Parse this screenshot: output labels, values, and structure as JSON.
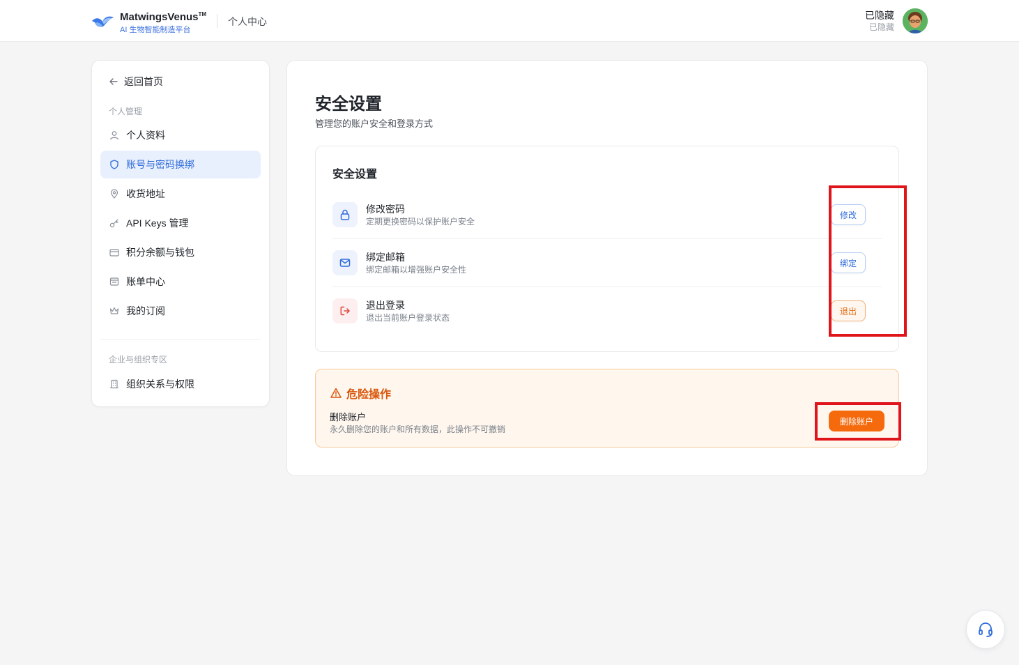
{
  "header": {
    "brand": "MatwingsVenus",
    "brand_tm": "TM",
    "brand_sub": "AI 生物智能制造平台",
    "crumb": "个人中心",
    "user_name": "已隐藏",
    "user_sub": "已隐藏"
  },
  "sidebar": {
    "back": "返回首页",
    "section_personal": "个人管理",
    "items": [
      {
        "label": "个人资料",
        "icon": "user-icon"
      },
      {
        "label": "账号与密码换绑",
        "icon": "shield-icon",
        "active": true
      },
      {
        "label": "收货地址",
        "icon": "map-pin-icon"
      },
      {
        "label": "API Keys 管理",
        "icon": "key-icon"
      },
      {
        "label": "积分余额与钱包",
        "icon": "credit-card-icon"
      },
      {
        "label": "账单中心",
        "icon": "bill-icon"
      },
      {
        "label": "我的订阅",
        "icon": "crown-icon"
      }
    ],
    "section_org": "企业与组织专区",
    "org_items": [
      {
        "label": "组织关系与权限",
        "icon": "building-icon"
      }
    ]
  },
  "main": {
    "title": "安全设置",
    "desc": "管理您的账户安全和登录方式",
    "security_card": {
      "title": "安全设置",
      "rows": [
        {
          "title": "修改密码",
          "desc": "定期更换密码以保护账户安全",
          "button": "修改",
          "icon": "lock-icon"
        },
        {
          "title": "绑定邮箱",
          "desc": "绑定邮箱以增强账户安全性",
          "button": "绑定",
          "icon": "mail-icon"
        },
        {
          "title": "退出登录",
          "desc": "退出当前账户登录状态",
          "button": "退出",
          "icon": "logout-icon"
        }
      ]
    },
    "danger_card": {
      "title": "危险操作",
      "item_title": "删除账户",
      "item_desc": "永久删除您的账户和所有数据，此操作不可撤销",
      "button": "删除账户"
    }
  },
  "colors": {
    "accent": "#2f6bdb",
    "danger": "#f56a0c",
    "highlight": "#e0151b"
  }
}
